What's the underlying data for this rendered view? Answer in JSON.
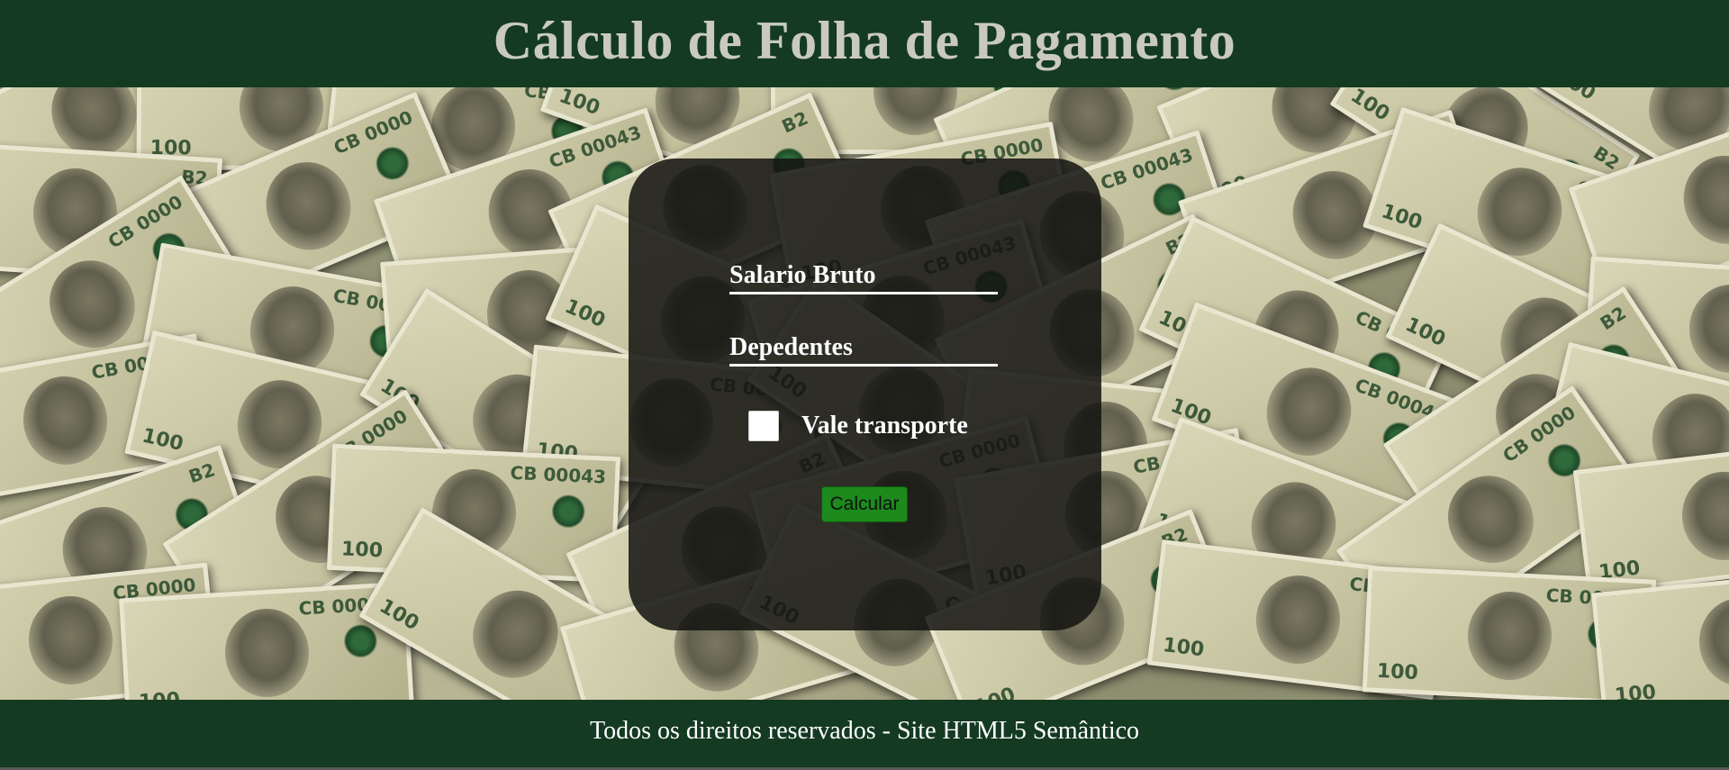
{
  "header": {
    "title": "Cálculo de Folha de Pagamento"
  },
  "form": {
    "salario_label": "Salario Bruto",
    "dependentes_label": "Depedentes",
    "vale_transporte_label": "Vale transporte",
    "vale_transporte_checked": false,
    "calcular_label": "Calcular"
  },
  "footer": {
    "text": "Todos os direitos reservados - Site HTML5 Semântico"
  },
  "colors": {
    "header_bg": "#143a22",
    "footer_bg": "#143a22",
    "panel_bg": "#141411",
    "button_bg": "#1c8a1c"
  },
  "background": {
    "image": "money-bills-background"
  },
  "bill_labels": [
    "100",
    "CB 00043",
    "B2",
    "CB 0000"
  ]
}
